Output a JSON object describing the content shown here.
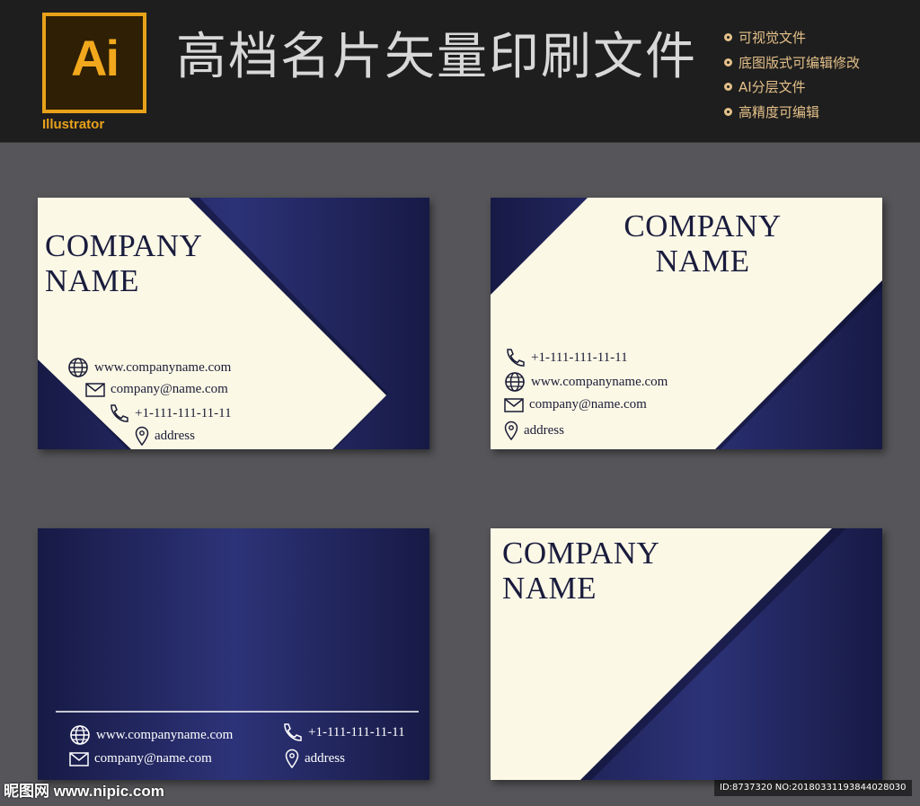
{
  "banner": {
    "logo_text": "Ai",
    "logo_caption": "Illustrator",
    "title": "高档名片矢量印刷文件",
    "features": [
      "可视觉文件",
      "底图版式可编辑修改",
      "AI分层文件",
      "高精度可编辑"
    ]
  },
  "cards": [
    {
      "company": "COMPANY\nNAME",
      "website": "www.companyname.com",
      "email": "company@name.com",
      "phone": "+1-111-111-11-11",
      "address": "address"
    },
    {
      "company": "COMPANY\nNAME",
      "phone": "+1-111-111-11-11",
      "website": "www.companyname.com",
      "email": "company@name.com",
      "address": "address"
    },
    {
      "website": "www.companyname.com",
      "email": "company@name.com",
      "phone": "+1-111-111-11-11",
      "address": "address"
    },
    {
      "company": "COMPANY\nNAME"
    }
  ],
  "watermark": "昵图网 www.nipic.com",
  "image_id": "ID:8737320 NO:20180331193844028030",
  "colors": {
    "navy": "#1d2052",
    "cream": "#fbf8e6",
    "gold": "#e8a21a",
    "background": "#565559"
  },
  "icons": [
    "globe-icon",
    "envelope-icon",
    "phone-icon",
    "location-pin-icon"
  ]
}
